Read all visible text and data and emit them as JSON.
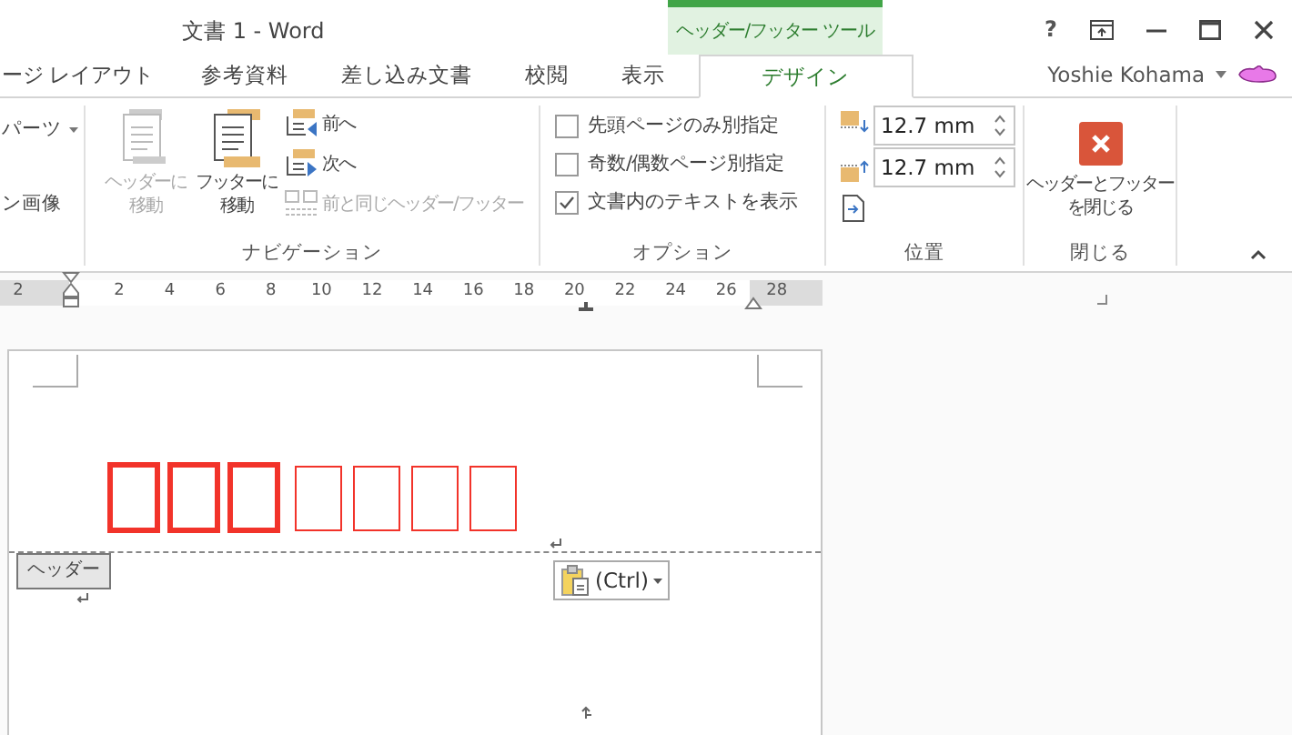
{
  "window": {
    "title": "文書 1 - Word",
    "help": "?"
  },
  "context_group": {
    "label": "ヘッダー/フッター ツール"
  },
  "tabs": [
    {
      "label": "ージ レイアウト",
      "selected": false
    },
    {
      "label": "参考資料",
      "selected": false
    },
    {
      "label": "差し込み文書",
      "selected": false
    },
    {
      "label": "校閲",
      "selected": false
    },
    {
      "label": "表示",
      "selected": false
    },
    {
      "label": "デザイン",
      "selected": true
    }
  ],
  "user": {
    "name": "Yoshie Kohama"
  },
  "ribbon": {
    "partial_group": {
      "items": [
        "パーツ",
        "ン画像"
      ]
    },
    "navigation": {
      "label": "ナビゲーション",
      "large_buttons": [
        {
          "lines": [
            "ヘッダーに",
            "移動"
          ],
          "disabled": true
        },
        {
          "lines": [
            "フッターに",
            "移動"
          ],
          "disabled": false
        }
      ],
      "small_buttons": [
        {
          "label": "前へ",
          "disabled": false,
          "kind": "prev"
        },
        {
          "label": "次へ",
          "disabled": false,
          "kind": "next"
        },
        {
          "label": "前と同じヘッダー/フッター",
          "disabled": true,
          "kind": "link"
        }
      ]
    },
    "options": {
      "label": "オプション",
      "checkboxes": [
        {
          "label": "先頭ページのみ別指定",
          "checked": false
        },
        {
          "label": "奇数/偶数ページ別指定",
          "checked": false
        },
        {
          "label": "文書内のテキストを表示",
          "checked": true
        }
      ]
    },
    "position": {
      "label": "位置",
      "spinners": [
        {
          "value": "12.7 mm",
          "kind": "top"
        },
        {
          "value": "12.7 mm",
          "kind": "bottom"
        }
      ]
    },
    "close": {
      "label": "閉じる",
      "button_lines": [
        "ヘッダーとフッター",
        "を閉じる"
      ]
    }
  },
  "ruler": {
    "labels": [
      "2",
      "2",
      "4",
      "6",
      "8",
      "10",
      "12",
      "14",
      "16",
      "18",
      "20",
      "22",
      "24",
      "26",
      "28"
    ]
  },
  "document": {
    "glyph_boxes": [
      {
        "bold": true
      },
      {
        "bold": true
      },
      {
        "bold": true
      },
      {
        "bold": false
      },
      {
        "bold": false
      },
      {
        "bold": false
      },
      {
        "bold": false
      }
    ],
    "header_tag": "ヘッダー",
    "paste_button": "(Ctrl)"
  }
}
